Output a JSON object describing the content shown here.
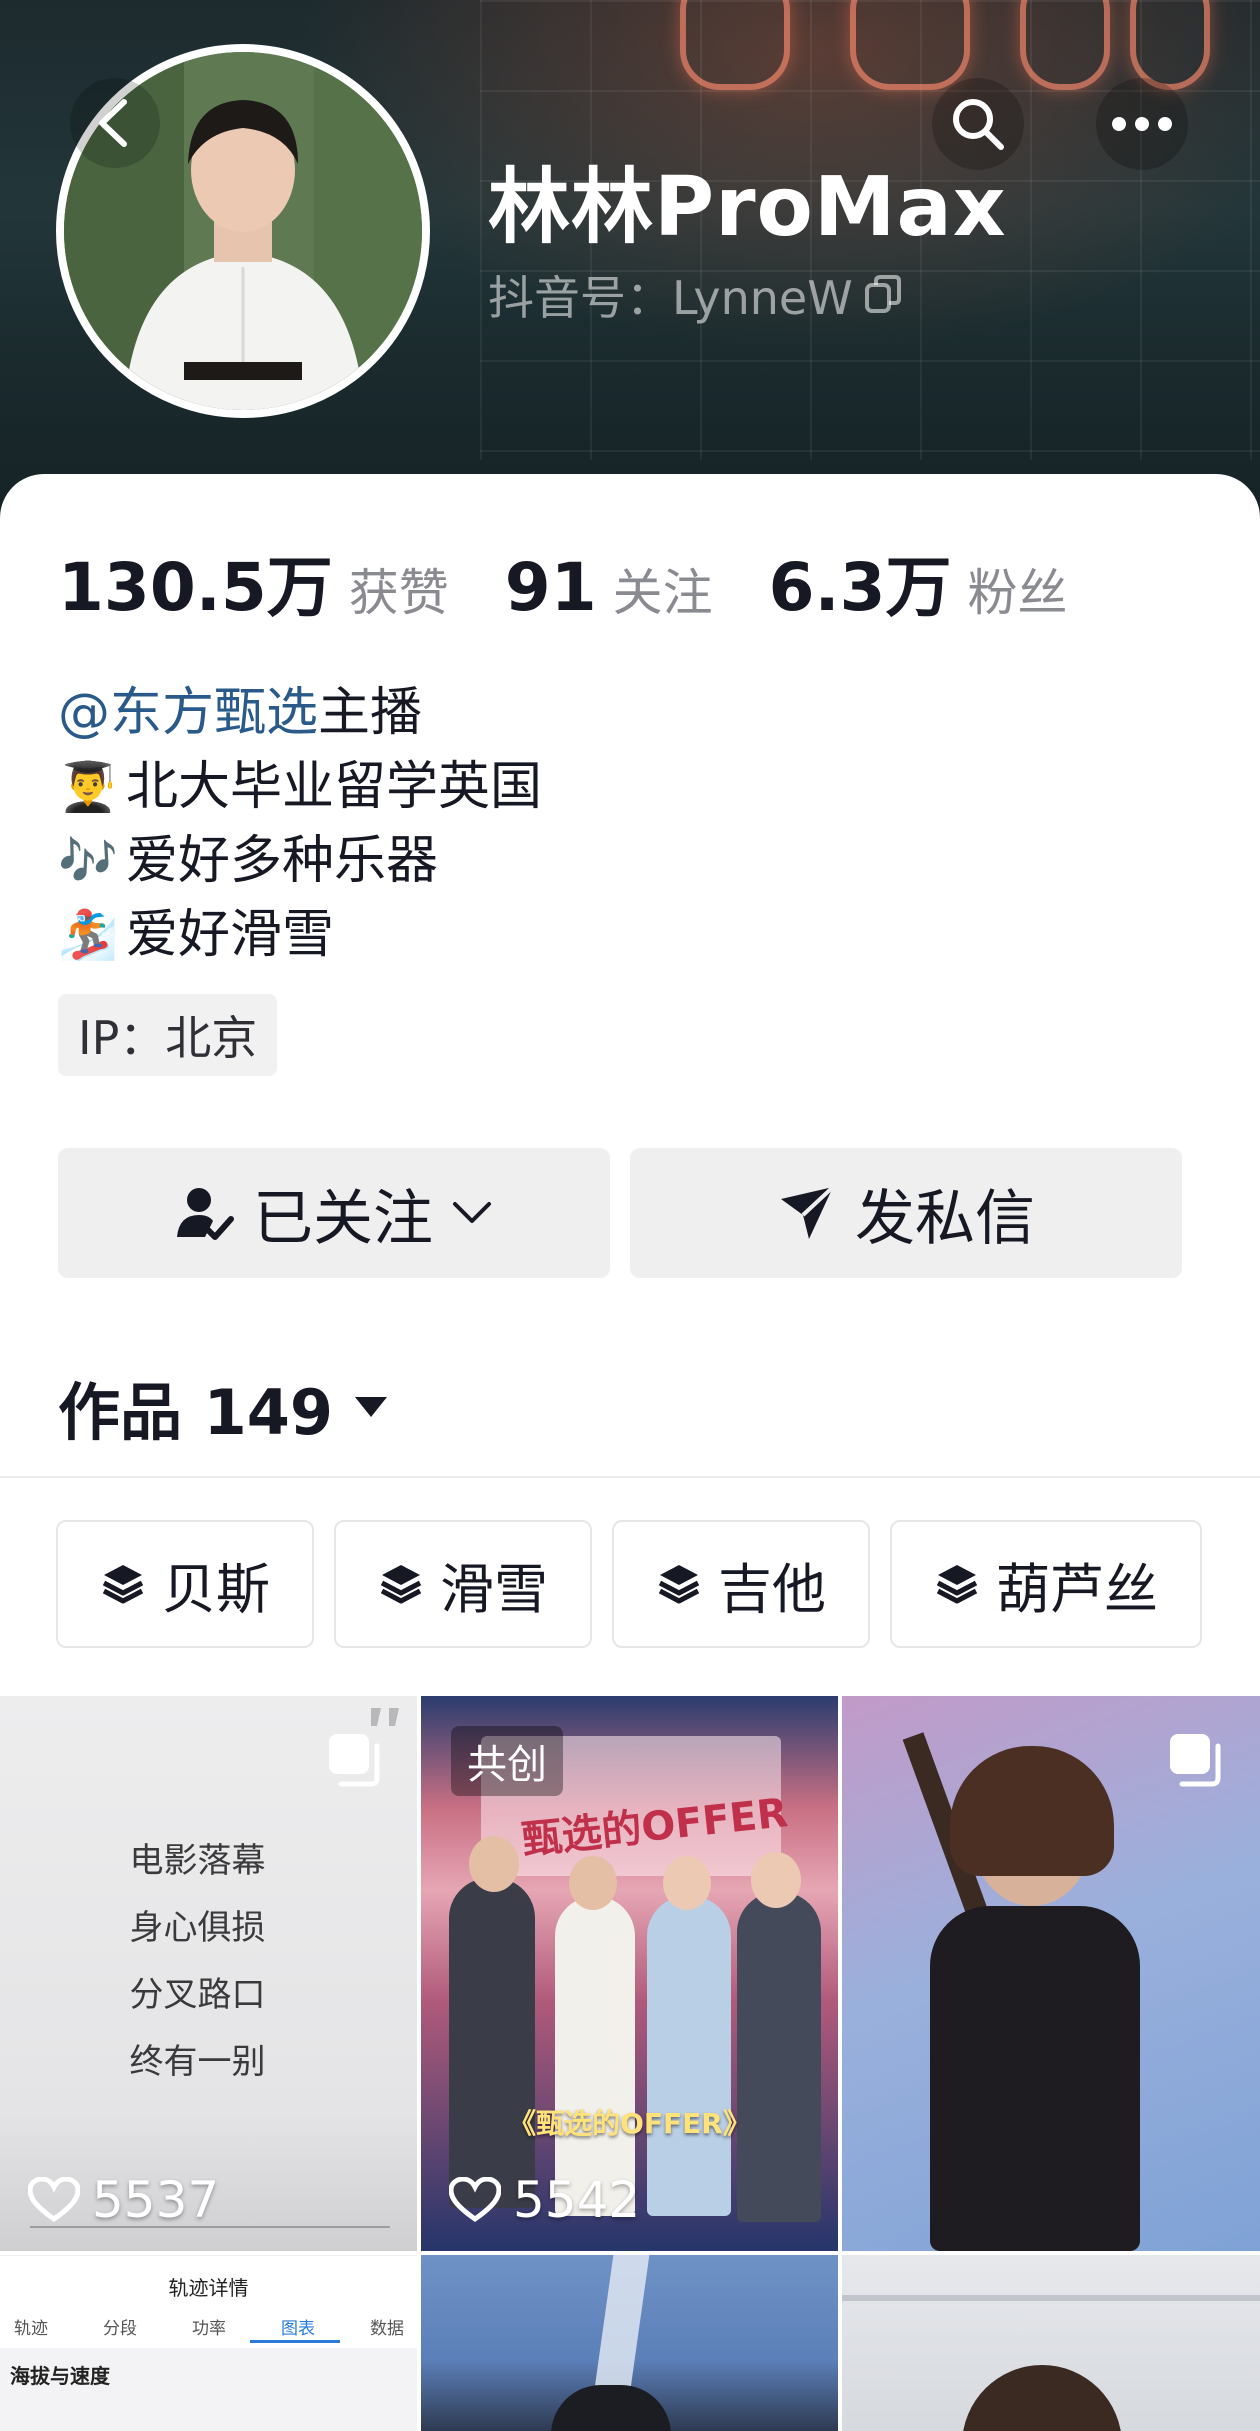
{
  "profile": {
    "nickname": "林林ProMax",
    "douyin_id": "抖音号：LynneW"
  },
  "stats": [
    {
      "value": "130.5万",
      "label": "获赞"
    },
    {
      "value": "91",
      "label": "关注"
    },
    {
      "value": "6.3万",
      "label": "粉丝"
    }
  ],
  "bio": {
    "mention": "@东方甄选",
    "role": " 主播",
    "lines": [
      {
        "emoji": "👨‍🎓",
        "text": "北大毕业留学英国"
      },
      {
        "emoji": "🎶",
        "text": "爱好多种乐器"
      },
      {
        "emoji": "🏂",
        "text": "爱好滑雪"
      }
    ]
  },
  "ip": "IP：北京",
  "actions": {
    "follow_label": "已关注",
    "message_label": "发私信"
  },
  "works": {
    "label": "作品 149"
  },
  "collections": [
    "贝斯",
    "滑雪",
    "吉他",
    "葫芦丝"
  ],
  "grid": {
    "tile1": {
      "lines": [
        "电影落幕",
        "身心俱损",
        "分叉路口",
        "终有一别"
      ],
      "likes": "5537"
    },
    "tile2": {
      "badge": "共创",
      "caption": "《甄选的OFFER》",
      "poster_title": "甄选的OFFER",
      "likes": "5542"
    },
    "tile4": {
      "title": "轨迹详情",
      "tabs": [
        "轨迹",
        "分段",
        "功率",
        "图表",
        "数据"
      ],
      "section": "海拔与速度"
    }
  },
  "colors": {
    "mention": "#2a5a8a",
    "button_bg": "#efeff0",
    "text_primary": "#161823",
    "text_secondary": "#8a8b91"
  }
}
